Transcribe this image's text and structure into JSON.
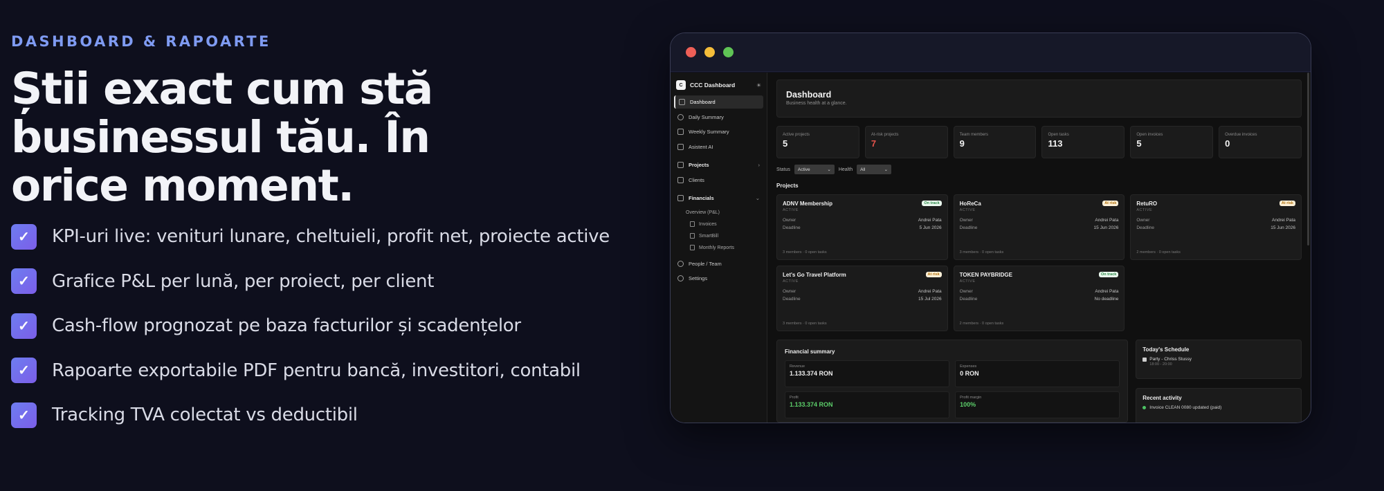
{
  "hero": {
    "eyebrow": "DASHBOARD & RAPOARTE",
    "headline": "Știi exact cum stă businessul tău. În orice moment.",
    "check_glyph": "✓",
    "features": [
      "KPI-uri live: venituri lunare, cheltuieli, profit net, proiecte active",
      "Grafice P&L per lună, per proiect, per client",
      "Cash-flow prognozat pe baza facturilor și scadențelor",
      "Rapoarte exportabile PDF pentru bancă, investitori, contabil",
      "Tracking TVA colectat vs deductibil"
    ]
  },
  "window": {
    "dot_colors": [
      "#ee5f57",
      "#f5bd3a",
      "#5fc455"
    ]
  },
  "sidebar": {
    "brand_letter": "C",
    "brand_name": "CCC Dashboard",
    "nav": {
      "dashboard": "Dashboard",
      "daily": "Daily Summary",
      "weekly": "Weekly Summary",
      "ai": "Asistent AI",
      "projects": "Projects",
      "clients": "Clients",
      "financials": "Financials",
      "overview": "Overview (P&L)",
      "invoices": "Invoices",
      "smartbill": "SmartBill",
      "monthly": "Monthly Reports",
      "people": "People / Team",
      "settings": "Settings"
    }
  },
  "header": {
    "title": "Dashboard",
    "subtitle": "Business health at a glance."
  },
  "kpis": [
    {
      "label": "Active projects",
      "value": "5"
    },
    {
      "label": "At-risk projects",
      "value": "7"
    },
    {
      "label": "Team members",
      "value": "9"
    },
    {
      "label": "Open tasks",
      "value": "113"
    },
    {
      "label": "Open invoices",
      "value": "5"
    },
    {
      "label": "Overdue invoices",
      "value": "0"
    }
  ],
  "filters": {
    "status_label": "Status",
    "status_value": "Active",
    "health_label": "Health",
    "health_value": "All"
  },
  "projects_title": "Projects",
  "projects": [
    {
      "name": "ADNV Membership",
      "status": "ACTIVE",
      "badge": "On track",
      "owner_label": "Owner",
      "owner": "Andrei Pata",
      "deadline_label": "Deadline",
      "deadline": "5 Jun 2026",
      "footer": "3 members · 0 open tasks"
    },
    {
      "name": "HoReCa",
      "status": "ACTIVE",
      "badge": "At risk",
      "owner_label": "Owner",
      "owner": "Andrei Pata",
      "deadline_label": "Deadline",
      "deadline": "15 Jun 2026",
      "footer": "3 members · 0 open tasks"
    },
    {
      "name": "RetuRO",
      "status": "ACTIVE",
      "badge": "At risk",
      "owner_label": "Owner",
      "owner": "Andrei Pata",
      "deadline_label": "Deadline",
      "deadline": "15 Jun 2026",
      "footer": "2 members · 0 open tasks"
    },
    {
      "name": "Let's Go Travel Platform",
      "status": "ACTIVE",
      "badge": "At risk",
      "owner_label": "Owner",
      "owner": "Andrei Pata",
      "deadline_label": "Deadline",
      "deadline": "15 Jul 2026",
      "footer": "3 members · 0 open tasks"
    },
    {
      "name": "TOKEN PAYBRIDGE",
      "status": "ACTIVE",
      "badge": "On track",
      "owner_label": "Owner",
      "owner": "Andrei Pata",
      "deadline_label": "Deadline",
      "deadline": "No deadline",
      "footer": "2 members · 0 open tasks"
    }
  ],
  "financial": {
    "title": "Financial summary",
    "revenue_label": "Revenue",
    "revenue": "1.133.374 RON",
    "expenses_label": "Expenses",
    "expenses": "0 RON",
    "profit_label": "Profit",
    "profit": "1.133.374 RON",
    "margin_label": "Profit margin",
    "margin": "100%"
  },
  "schedule": {
    "title": "Today's Schedule",
    "event": "Party - Chriss Stussy",
    "time": "18:00 - 20:00"
  },
  "recent": {
    "title": "Recent activity",
    "item": "Invoice CLEAN 0080 updated (paid)"
  }
}
